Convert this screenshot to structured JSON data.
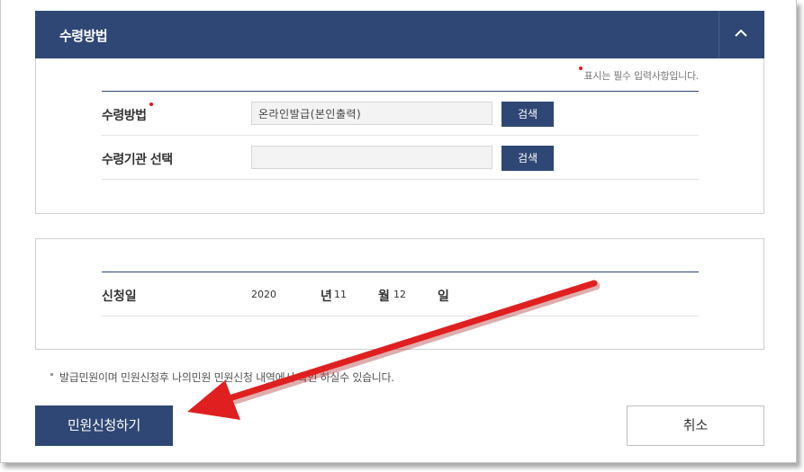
{
  "panel": {
    "title": "수령방법",
    "collapse_icon": "chevron-up-icon"
  },
  "required_note": "표시는 필수 입력사항입니다.",
  "form": {
    "rows": [
      {
        "label": "수령방법",
        "required": true,
        "value": "온라인발급(본인출력)",
        "button": "검색"
      },
      {
        "label": "수령기관 선택",
        "required": false,
        "value": "",
        "button": "검색"
      }
    ]
  },
  "application_date": {
    "label": "신청일",
    "year": "2020",
    "year_unit": "년",
    "month": "11",
    "month_unit": "월",
    "day": "12",
    "day_unit": "일"
  },
  "notice": "발급민원이며 민원신청후 나의민원 민원신청 내역에서 확인 하실수 있습니다.",
  "buttons": {
    "submit": "민원신청하기",
    "cancel": "취소"
  },
  "colors": {
    "primary": "#2f4774",
    "required_dot": "#e1161b",
    "annotation_arrow": "#e02020"
  }
}
